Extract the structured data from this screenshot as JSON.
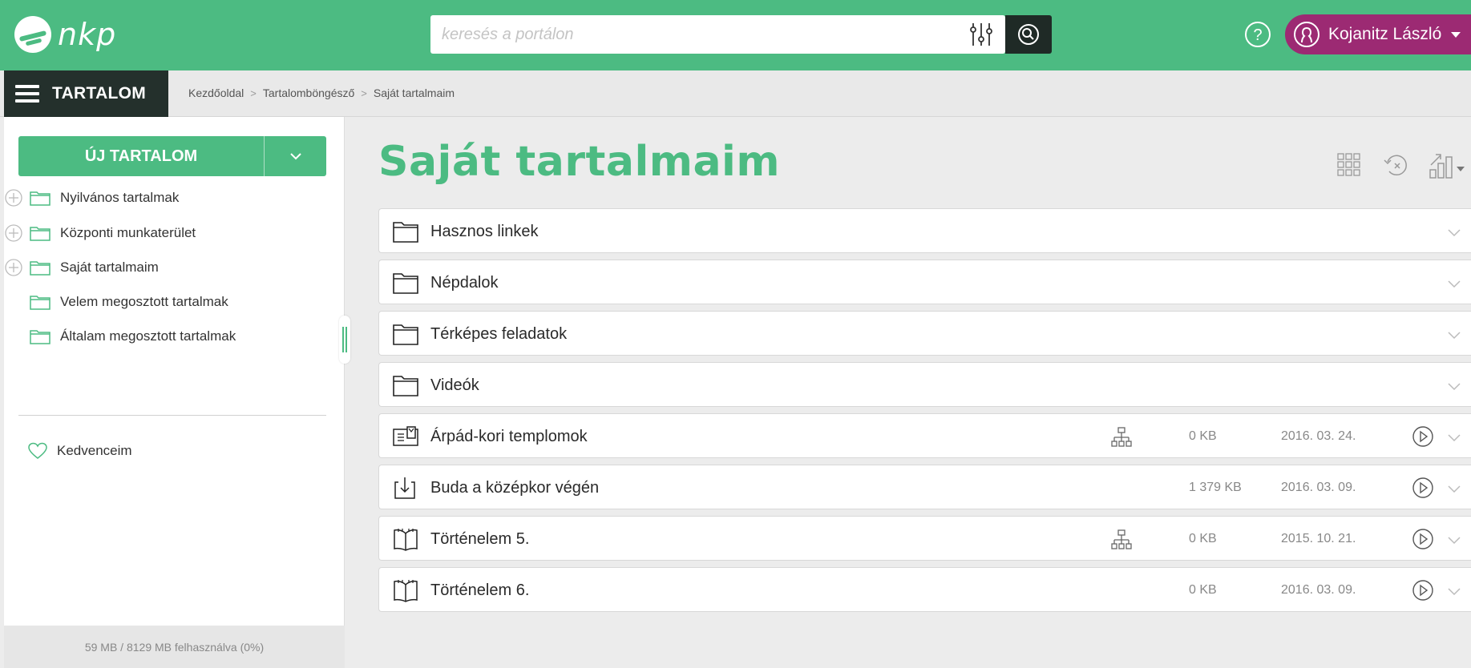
{
  "header": {
    "logo_text": "nkp",
    "search_placeholder": "keresés a portálon",
    "user_name": "Kojanitz László"
  },
  "subbar": {
    "menu_label": "TARTALOM",
    "breadcrumb": [
      "Kezdőoldal",
      "Tartalomböngésző",
      "Saját tartalmaim"
    ]
  },
  "sidebar": {
    "new_button_label": "ÚJ TARTALOM",
    "tree": [
      {
        "label": "Nyilvános tartalmak",
        "expandable": true
      },
      {
        "label": "Központi munkaterület",
        "expandable": true
      },
      {
        "label": "Saját tartalmaim",
        "expandable": true
      },
      {
        "label": "Velem megosztott tartalmak",
        "expandable": false
      },
      {
        "label": "Általam megosztott tartalmak",
        "expandable": false
      }
    ],
    "favorites_label": "Kedvenceim",
    "storage_text": "59 MB / 8129 MB felhasználva (0%)"
  },
  "main": {
    "title": "Saját tartalmaim",
    "items": [
      {
        "name": "Hasznos linkek",
        "type": "folder",
        "shared": false,
        "size": "",
        "date": ""
      },
      {
        "name": "Népdalok",
        "type": "folder",
        "shared": false,
        "size": "",
        "date": ""
      },
      {
        "name": "Térképes feladatok",
        "type": "folder",
        "shared": false,
        "size": "",
        "date": ""
      },
      {
        "name": "Videók",
        "type": "folder",
        "shared": false,
        "size": "",
        "date": ""
      },
      {
        "name": "Árpád-kori templomok",
        "type": "presentation",
        "shared": true,
        "size": "0 KB",
        "date": "2016. 03. 24."
      },
      {
        "name": "Buda a középkor végén",
        "type": "download",
        "shared": false,
        "size": "1 379 KB",
        "date": "2016. 03. 09."
      },
      {
        "name": "Történelem 5.",
        "type": "book",
        "shared": true,
        "size": "0 KB",
        "date": "2015. 10. 21."
      },
      {
        "name": "Történelem 6.",
        "type": "book",
        "shared": false,
        "size": "0 KB",
        "date": "2016. 03. 09."
      }
    ]
  },
  "colors": {
    "brand_green": "#4cbb82",
    "dark": "#24302c",
    "user_purple": "#9c2a73"
  }
}
